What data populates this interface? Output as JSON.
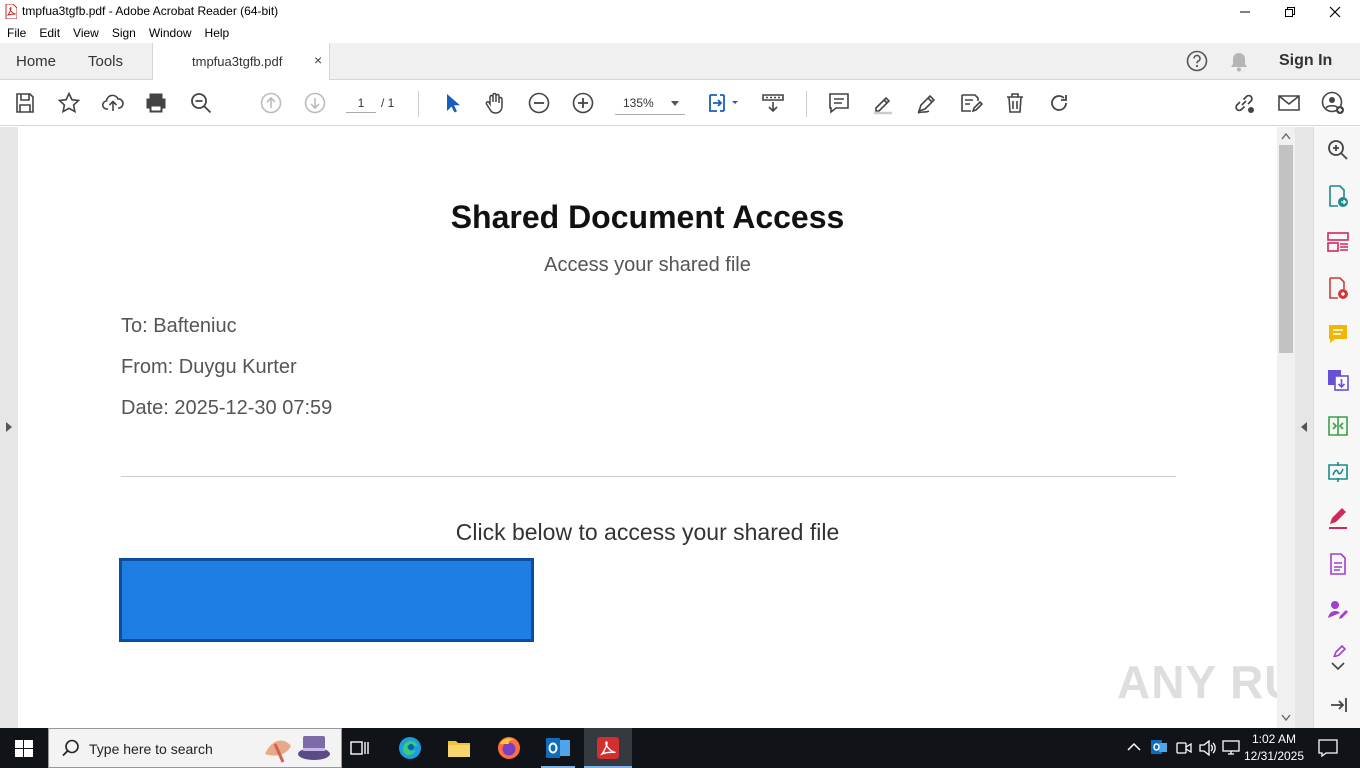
{
  "window": {
    "title": "tmpfua3tgfb.pdf - Adobe Acrobat Reader (64-bit)"
  },
  "menu": [
    "File",
    "Edit",
    "View",
    "Sign",
    "Window",
    "Help"
  ],
  "tabs": {
    "home": "Home",
    "tools": "Tools",
    "document": "tmpfua3tgfb.pdf",
    "close": "×"
  },
  "header": {
    "sign_in": "Sign In"
  },
  "toolbar": {
    "page_current": "1",
    "page_total": "/ 1",
    "zoom": "135%"
  },
  "document": {
    "title": "Shared Document Access",
    "subtitle": "Access your shared file",
    "to": "To: Bafteniuc",
    "from": "From: Duygu Kurter",
    "date": "Date: 2025-12-30 07:59",
    "cta_text": "Click below to access your shared file"
  },
  "watermark": "ANY RUN",
  "taskbar": {
    "search_placeholder": "Type here to search",
    "time": "1:02 AM",
    "date": "12/31/2025"
  },
  "colors": {
    "accent_button": "#1e7ee4",
    "acrobat_red": "#d32f2f",
    "toolbar_blue": "#1a5ebd"
  }
}
